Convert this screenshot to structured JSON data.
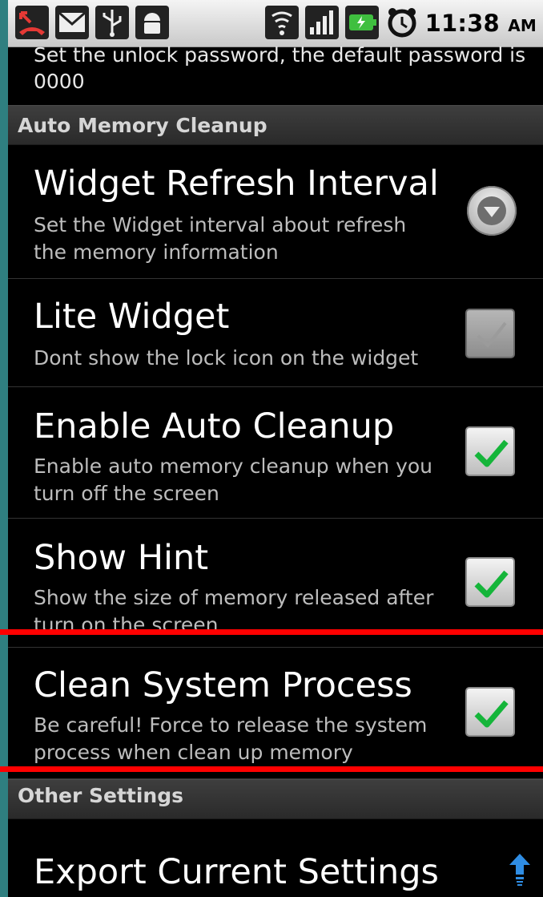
{
  "status_bar": {
    "time": "11:38",
    "ampm": "AM",
    "left_icons": [
      "missed-call-icon",
      "gmail-icon",
      "usb-icon",
      "android-debug-icon"
    ],
    "right_icons": [
      "wifi-icon",
      "signal-icon",
      "battery-charging-icon",
      "alarm-icon"
    ]
  },
  "clipped_summary": "Set the unlock password, the default password is 0000",
  "sections": {
    "auto_memory_cleanup": "Auto Memory Cleanup",
    "other_settings": "Other Settings"
  },
  "preferences": [
    {
      "title": "Widget Refresh Interval",
      "summary": "Set the Widget interval about refresh the memory information",
      "control": "dropdown"
    },
    {
      "title": "Lite Widget",
      "summary": "Dont show the lock icon on the widget",
      "control": "checkbox",
      "checked": false,
      "enabled": false
    },
    {
      "title": "Enable Auto Cleanup",
      "summary": "Enable auto memory cleanup when you turn off the screen",
      "control": "checkbox",
      "checked": true
    },
    {
      "title": "Show Hint",
      "summary": "Show the size of memory released after turn on the screen",
      "control": "checkbox",
      "checked": true
    },
    {
      "title": "Clean System Process",
      "summary": "Be careful! Force to release the system process when clean up memory",
      "control": "checkbox",
      "checked": true
    },
    {
      "title": "Export Current Settings",
      "control": "export-icon"
    }
  ],
  "colors": {
    "highlight": "#ff0000",
    "check_green": "#15b53a",
    "outer_background": "#2f7f80"
  }
}
